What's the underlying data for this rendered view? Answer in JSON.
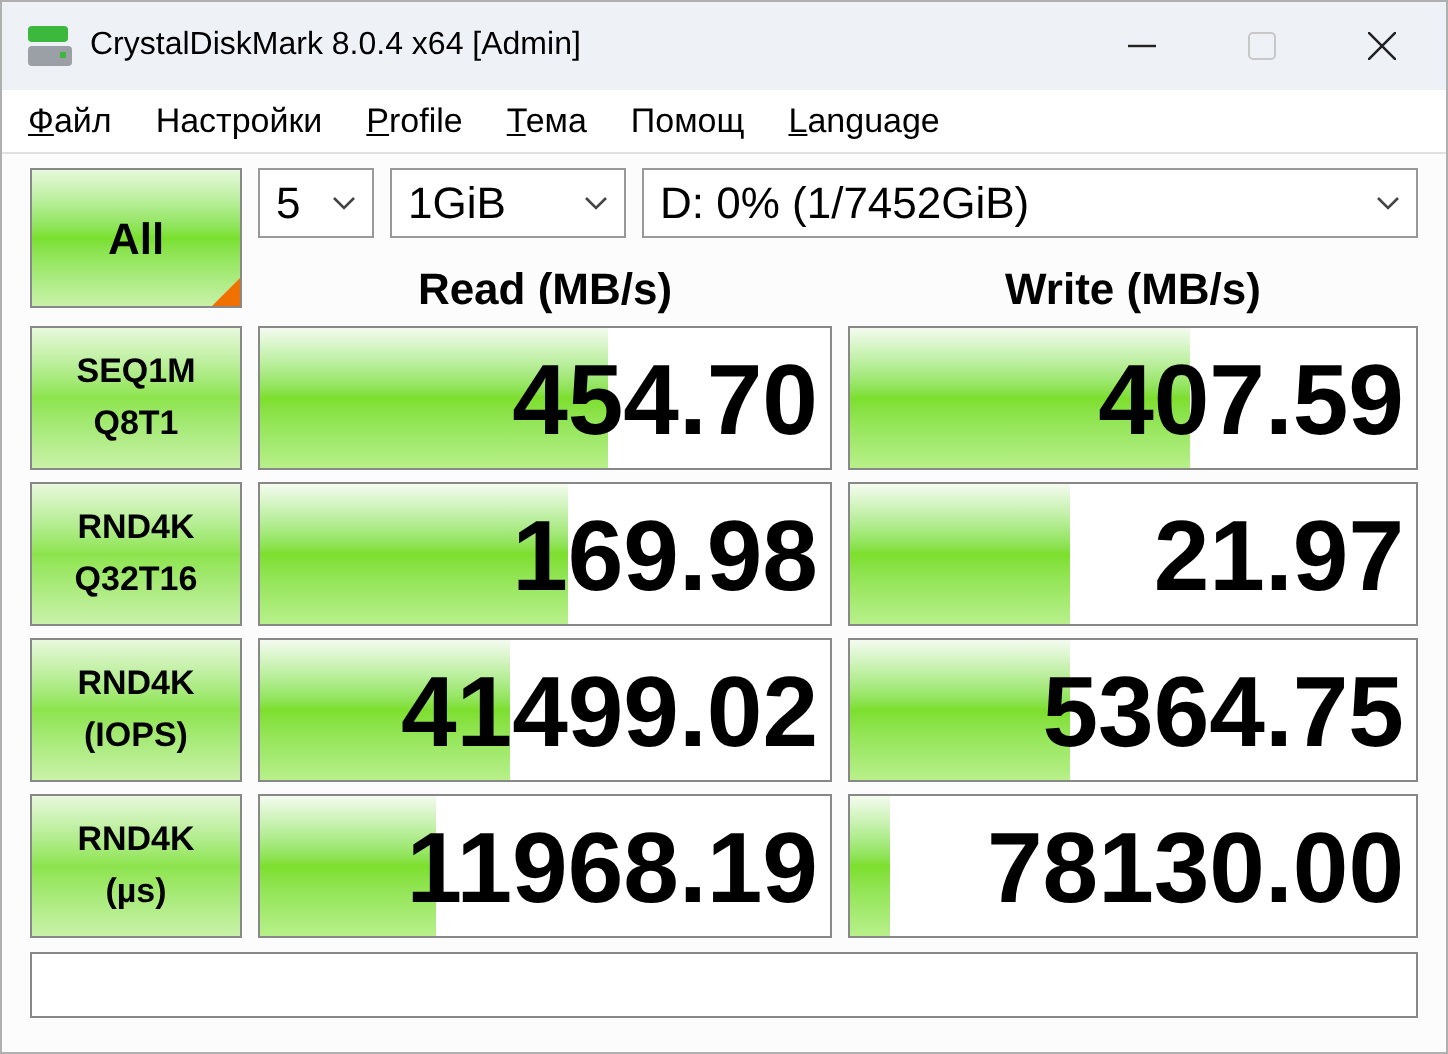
{
  "window": {
    "title": "CrystalDiskMark 8.0.4 x64 [Admin]",
    "maximize_disabled": true
  },
  "menu": [
    {
      "label": "Файл",
      "mnemonic": true
    },
    {
      "label": "Настройки",
      "mnemonic": false
    },
    {
      "label": "Profile",
      "mnemonic": true
    },
    {
      "label": "Тема",
      "mnemonic": true
    },
    {
      "label": "Помощ",
      "mnemonic": false
    },
    {
      "label": "Language",
      "mnemonic": true
    }
  ],
  "all_button": {
    "label": "All"
  },
  "selectors": [
    {
      "value": "5"
    },
    {
      "value": "1GiB"
    },
    {
      "value": "D: 0% (1/7452GiB)"
    }
  ],
  "headers": [
    "Read (MB/s)",
    "Write (MB/s)"
  ],
  "rows": [
    {
      "label": [
        "SEQ1M",
        "Q8T1"
      ],
      "read": {
        "value": "454.70",
        "level": 0.61
      },
      "write": {
        "value": "407.59",
        "level": 0.6
      }
    },
    {
      "label": [
        "RND4K",
        "Q32T16"
      ],
      "read": {
        "value": "169.98",
        "level": 0.54
      },
      "write": {
        "value": "21.97",
        "level": 0.39
      }
    },
    {
      "label": [
        "RND4K",
        "(IOPS)"
      ],
      "read": {
        "value": "41499.02",
        "level": 0.44
      },
      "write": {
        "value": "5364.75",
        "level": 0.39
      }
    },
    {
      "label": [
        "RND4K",
        "(µs)"
      ],
      "read": {
        "value": "11968.19",
        "level": 0.31
      },
      "write": {
        "value": "78130.00",
        "level": 0.07
      }
    }
  ]
}
